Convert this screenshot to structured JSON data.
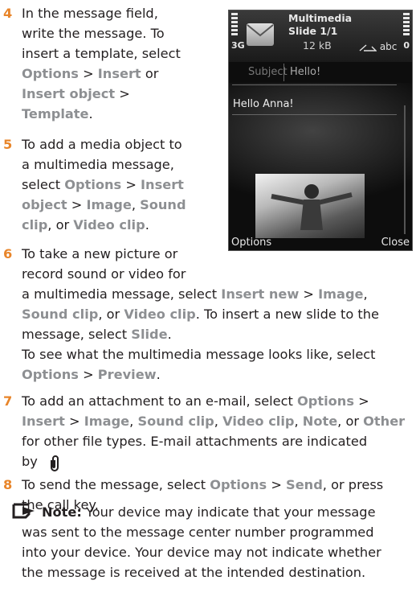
{
  "steps": [
    {
      "number": "4",
      "lines": [
        [
          {
            "t": "In the message field,"
          }
        ],
        [
          {
            "t": "write the message. To"
          }
        ],
        [
          {
            "t": "insert a template, select"
          }
        ],
        [
          {
            "t": "Options",
            "k": 1
          },
          {
            "t": " > "
          },
          {
            "t": "Insert",
            "k": 1
          },
          {
            "t": " or"
          }
        ],
        [
          {
            "t": "Insert object",
            "k": 1
          },
          {
            "t": " >"
          }
        ],
        [
          {
            "t": "Template",
            "k": 1
          },
          {
            "t": "."
          }
        ]
      ]
    },
    {
      "number": "5",
      "lines": [
        [
          {
            "t": "To add a media object to"
          }
        ],
        [
          {
            "t": "a multimedia message,"
          }
        ],
        [
          {
            "t": "select "
          },
          {
            "t": "Options",
            "k": 1
          },
          {
            "t": " > "
          },
          {
            "t": "Insert",
            "k": 1
          }
        ],
        [
          {
            "t": "object",
            "k": 1
          },
          {
            "t": " > "
          },
          {
            "t": "Image",
            "k": 1
          },
          {
            "t": ", "
          },
          {
            "t": "Sound",
            "k": 1
          }
        ],
        [
          {
            "t": "clip",
            "k": 1
          },
          {
            "t": ", or "
          },
          {
            "t": "Video clip",
            "k": 1
          },
          {
            "t": "."
          }
        ]
      ]
    },
    {
      "number": "6",
      "lines": [
        [
          {
            "t": "To take a new picture or"
          }
        ],
        [
          {
            "t": "record sound or video for"
          }
        ],
        [
          {
            "t": "a multimedia message, select "
          },
          {
            "t": "Insert new",
            "k": 1
          },
          {
            "t": " > "
          },
          {
            "t": "Image",
            "k": 1
          },
          {
            "t": ","
          }
        ],
        [
          {
            "t": "Sound clip",
            "k": 1
          },
          {
            "t": ", or "
          },
          {
            "t": "Video clip",
            "k": 1
          },
          {
            "t": ". To insert a new slide to the"
          }
        ],
        [
          {
            "t": "message, select "
          },
          {
            "t": "Slide",
            "k": 1
          },
          {
            "t": "."
          }
        ],
        [
          {
            "t": "To see what the multimedia message looks like, select"
          }
        ],
        [
          {
            "t": "Options",
            "k": 1
          },
          {
            "t": " > "
          },
          {
            "t": "Preview",
            "k": 1
          },
          {
            "t": "."
          }
        ]
      ]
    },
    {
      "number": "7",
      "lines": [
        [
          {
            "t": "To add an attachment to an e-mail, select "
          },
          {
            "t": "Options",
            "k": 1
          },
          {
            "t": " >"
          }
        ],
        [
          {
            "t": "Insert",
            "k": 1
          },
          {
            "t": " > "
          },
          {
            "t": "Image",
            "k": 1
          },
          {
            "t": ", "
          },
          {
            "t": "Sound clip",
            "k": 1
          },
          {
            "t": ", "
          },
          {
            "t": "Video clip",
            "k": 1
          },
          {
            "t": ", "
          },
          {
            "t": "Note",
            "k": 1
          },
          {
            "t": ", or "
          },
          {
            "t": "Other",
            "k": 1
          }
        ],
        [
          {
            "t": "for other file types. E-mail attachments are indicated"
          }
        ],
        [
          {
            "t": "by "
          }
        ]
      ]
    },
    {
      "number": "8",
      "lines": [
        [
          {
            "t": "To send the message, select "
          },
          {
            "t": "Options",
            "k": 1
          },
          {
            "t": " > "
          },
          {
            "t": "Send",
            "k": 1
          },
          {
            "t": ", or press"
          }
        ],
        [
          {
            "t": "the call key."
          }
        ]
      ]
    }
  ],
  "note": {
    "label": "Note:",
    "lines": [
      " Your device may indicate that your message",
      "was sent to the message center number programmed",
      "into your device. Your device may not indicate whether",
      "the message is received at the intended destination."
    ]
  },
  "phone": {
    "title_line1": "Multimedia",
    "title_line2": "Slide 1/1",
    "size": "12 kB",
    "mode": "abc",
    "left_indicator": "3G",
    "right_indicator": "0",
    "subject_label": "Subject",
    "subject_value": "Hello!",
    "body": "Hello Anna!",
    "softkey_left": "Options",
    "softkey_right": "Close"
  },
  "colors": {
    "step_number": "#e8852a",
    "keyword": "#8d8f92",
    "text": "#231f20"
  },
  "icons": [
    "paperclip-icon",
    "note-icon",
    "envelope-icon",
    "signal-strength-icon",
    "battery-icon",
    "keyboard-mode-icon"
  ]
}
